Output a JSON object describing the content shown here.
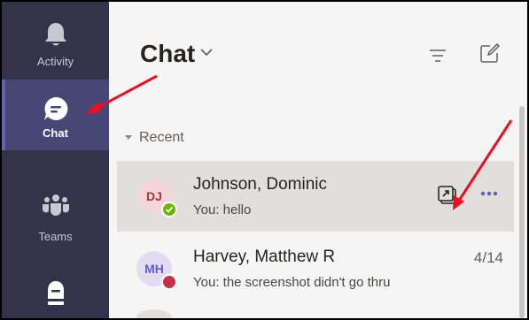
{
  "rail": {
    "items": [
      {
        "label": "Activity",
        "icon": "bell-icon"
      },
      {
        "label": "Chat",
        "icon": "chat-icon"
      },
      {
        "label": "Teams",
        "icon": "teams-icon"
      },
      {
        "label": "",
        "icon": "assignments-icon"
      }
    ],
    "active": "Chat"
  },
  "header": {
    "title": "Chat"
  },
  "section": {
    "label": "Recent"
  },
  "chats": [
    {
      "initials": "DJ",
      "name": "Johnson, Dominic",
      "preview": "You: hello",
      "date": "",
      "status": "available",
      "selected": true
    },
    {
      "initials": "MH",
      "name": "Harvey, Matthew R",
      "preview": "You: the screenshot didn't go thru",
      "date": "4/14",
      "status": "busy",
      "selected": false
    }
  ],
  "colors": {
    "rail_bg": "#33344a",
    "rail_active": "#464775",
    "accent": "#6264a7",
    "available": "#6bb700",
    "busy": "#c4314b",
    "annotation": "#e81123"
  }
}
